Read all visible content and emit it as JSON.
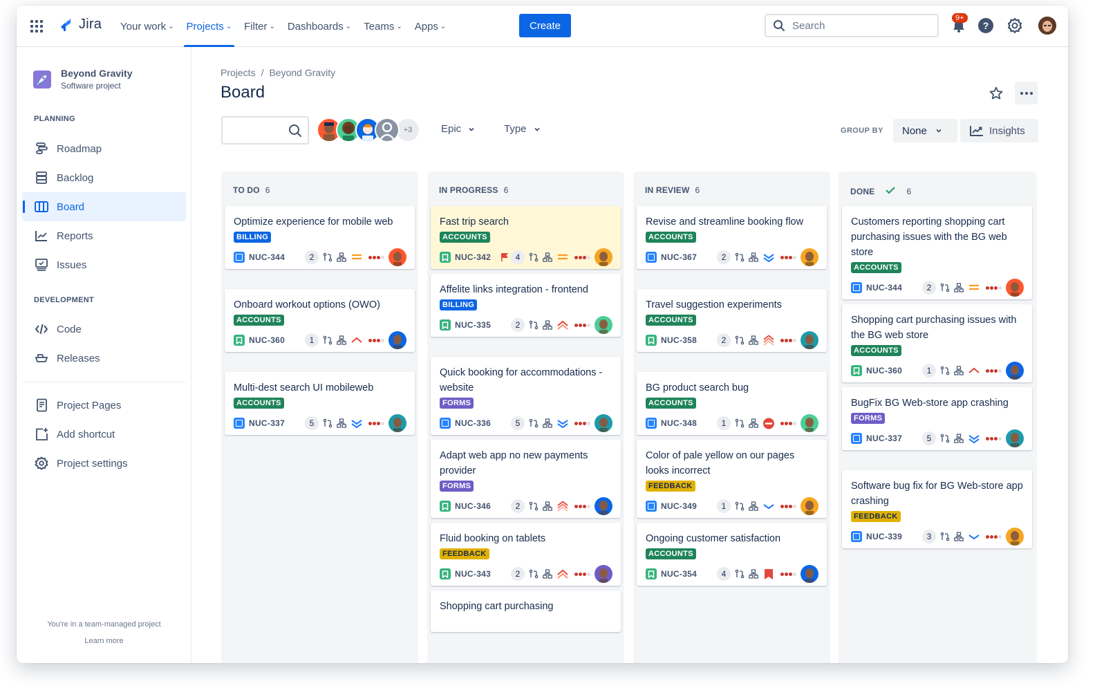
{
  "topnav": {
    "logo": "Jira",
    "items": [
      {
        "label": "Your work",
        "active": false
      },
      {
        "label": "Projects",
        "active": true
      },
      {
        "label": "Filter",
        "active": false
      },
      {
        "label": "Dashboards",
        "active": false
      },
      {
        "label": "Teams",
        "active": false
      },
      {
        "label": "Apps",
        "active": false
      }
    ],
    "create_label": "Create",
    "search_placeholder": "Search",
    "notification_badge": "9+",
    "help_glyph": "?"
  },
  "sidebar": {
    "project_name": "Beyond Gravity",
    "project_type": "Software project",
    "planning_title": "PLANNING",
    "planning_items": [
      {
        "label": "Roadmap",
        "icon": "roadmap-icon"
      },
      {
        "label": "Backlog",
        "icon": "backlog-icon"
      },
      {
        "label": "Board",
        "icon": "board-icon",
        "active": true
      },
      {
        "label": "Reports",
        "icon": "reports-icon"
      },
      {
        "label": "Issues",
        "icon": "issues-icon"
      }
    ],
    "development_title": "DEVELOPMENT",
    "development_items": [
      {
        "label": "Code",
        "icon": "code-icon"
      },
      {
        "label": "Releases",
        "icon": "releases-icon"
      }
    ],
    "other_items": [
      {
        "label": "Project Pages",
        "icon": "pages-icon"
      },
      {
        "label": "Add shortcut",
        "icon": "add-shortcut-icon"
      },
      {
        "label": "Project settings",
        "icon": "settings-icon"
      }
    ],
    "footer_text": "You're in a team-managed project",
    "footer_link": "Learn more"
  },
  "main": {
    "breadcrumb": [
      "Projects",
      "Beyond Gravity"
    ],
    "breadcrumb_sep": "/",
    "title": "Board",
    "avatars_more": "+3",
    "filters": [
      "Epic",
      "Type"
    ],
    "group_by_label": "GROUP BY",
    "group_by_value": "None",
    "insights_label": "Insights"
  },
  "columns": [
    {
      "title": "TO DO",
      "count": "6",
      "done_check": false,
      "cards": [
        {
          "title": "Optimize experience for mobile web",
          "label": "BILLING",
          "type": "task",
          "key": "NUC-344",
          "estimate": "2",
          "priority": "medium",
          "avatar": "#ff5630",
          "flagged": false
        },
        {
          "title": "Onboard workout options (OWO)",
          "label": "ACCOUNTS",
          "type": "story",
          "key": "NUC-360",
          "estimate": "1",
          "priority": "high",
          "avatar": "#0c66e4",
          "flagged": false
        },
        {
          "title": "Multi-dest search UI mobileweb",
          "label": "ACCOUNTS",
          "type": "task",
          "key": "NUC-337",
          "estimate": "5",
          "priority": "lowest",
          "avatar": "#1d9aaa",
          "flagged": false
        }
      ]
    },
    {
      "title": "IN PROGRESS",
      "count": "6",
      "done_check": false,
      "cards": [
        {
          "title": "Fast trip search",
          "label": "ACCOUNTS",
          "type": "story",
          "key": "NUC-342",
          "estimate": "4",
          "priority": "medium",
          "avatar": "#f5a623",
          "flagged": true
        },
        {
          "title": "Affelite links integration - frontend",
          "label": "BILLING",
          "type": "story",
          "key": "NUC-335",
          "estimate": "2",
          "priority": "highest",
          "avatar": "#4bce97",
          "flagged": false
        },
        {
          "title": "Quick booking for accommodations - website",
          "label": "FORMS",
          "type": "task",
          "key": "NUC-336",
          "estimate": "5",
          "priority": "lowest",
          "avatar": "#1d9aaa",
          "flagged": false
        },
        {
          "title": "Adapt web app no new payments provider",
          "label": "FORMS",
          "type": "story",
          "key": "NUC-346",
          "estimate": "2",
          "priority": "critical",
          "avatar": "#0c66e4",
          "flagged": false
        },
        {
          "title": "Fluid booking on tablets",
          "label": "FEEDBACK",
          "type": "story",
          "key": "NUC-343",
          "estimate": "2",
          "priority": "highest",
          "avatar": "#6e5dc6",
          "flagged": false
        },
        {
          "title": "Shopping cart purchasing",
          "label": "",
          "type": "",
          "key": "",
          "estimate": "",
          "priority": "",
          "avatar": "",
          "flagged": false
        }
      ]
    },
    {
      "title": "IN REVIEW",
      "count": "6",
      "done_check": false,
      "cards": [
        {
          "title": "Revise and streamline booking flow",
          "label": "ACCOUNTS",
          "type": "task",
          "key": "NUC-367",
          "estimate": "2",
          "priority": "lowest",
          "avatar": "#f5a623",
          "flagged": false
        },
        {
          "title": "Travel suggestion experiments",
          "label": "ACCOUNTS",
          "type": "story",
          "key": "NUC-358",
          "estimate": "2",
          "priority": "critical",
          "avatar": "#1d9aaa",
          "flagged": false
        },
        {
          "title": "BG product search bug",
          "label": "ACCOUNTS",
          "type": "task",
          "key": "NUC-348",
          "estimate": "1",
          "priority": "blocker",
          "avatar": "#4bce97",
          "flagged": false
        },
        {
          "title": "Color of pale yellow on our pages looks incorrect",
          "label": "FEEDBACK",
          "type": "task",
          "key": "NUC-349",
          "estimate": "1",
          "priority": "low",
          "avatar": "#f5a623",
          "flagged": false
        },
        {
          "title": "Ongoing customer satisfaction",
          "label": "ACCOUNTS",
          "type": "story",
          "key": "NUC-354",
          "estimate": "4",
          "priority": "major",
          "avatar": "#0c66e4",
          "flagged": false
        }
      ]
    },
    {
      "title": "DONE",
      "count": "6",
      "done_check": true,
      "cards": [
        {
          "title": "Customers reporting shopping cart purchasing issues with the BG web store",
          "label": "ACCOUNTS",
          "type": "task",
          "key": "NUC-344",
          "estimate": "2",
          "priority": "medium",
          "avatar": "#ff5630",
          "flagged": false
        },
        {
          "title": "Shopping cart purchasing issues with the BG web store",
          "label": "ACCOUNTS",
          "type": "story",
          "key": "NUC-360",
          "estimate": "1",
          "priority": "high",
          "avatar": "#0c66e4",
          "flagged": false
        },
        {
          "title": "BugFix BG Web-store app crashing",
          "label": "FORMS",
          "type": "task",
          "key": "NUC-337",
          "estimate": "5",
          "priority": "lowest",
          "avatar": "#1d9aaa",
          "flagged": false
        },
        {
          "title": "Software bug fix for BG Web-store app crashing",
          "label": "FEEDBACK",
          "type": "task",
          "key": "NUC-339",
          "estimate": "3",
          "priority": "low",
          "avatar": "#f5a623",
          "flagged": false
        }
      ]
    }
  ]
}
